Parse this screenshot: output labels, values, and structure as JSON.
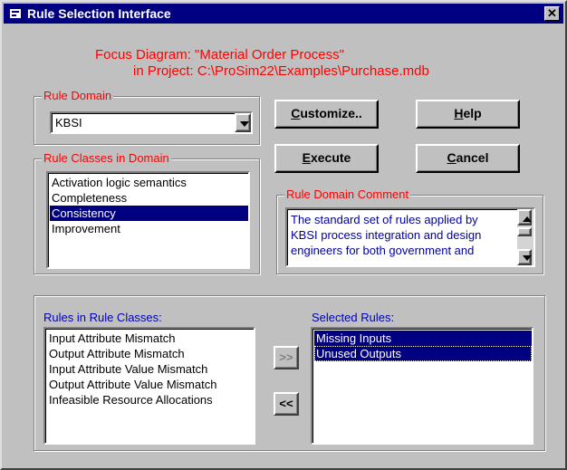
{
  "window": {
    "title": "Rule Selection Interface",
    "close_glyph": "✕"
  },
  "header": {
    "focus_line1": "Focus Diagram: \"Material Order Process\"",
    "focus_line2": "in Project: C:\\ProSim22\\Examples\\Purchase.mdb"
  },
  "rule_domain": {
    "legend": "Rule Domain",
    "selected": "KBSI"
  },
  "rule_classes": {
    "legend": "Rule Classes in Domain",
    "items": [
      "Activation logic semantics",
      "Completeness",
      "Consistency",
      "Improvement"
    ],
    "selected_index": 2
  },
  "buttons": {
    "customize_mn": "C",
    "customize_rest": "ustomize..",
    "help_mn": "H",
    "help_rest": "elp",
    "execute_mn": "E",
    "execute_rest": "xecute",
    "cancel_mn": "C",
    "cancel_rest": "ancel"
  },
  "comment": {
    "legend": "Rule Domain Comment",
    "text": "The standard set of rules applied by KBSI process integration and design engineers for both government and"
  },
  "rules": {
    "available_label": "Rules in Rule Classes:",
    "available": [
      "Input Attribute Mismatch",
      "Output Attribute Mismatch",
      "Input Attribute Value Mismatch",
      "Output Attribute Value Mismatch",
      "Infeasible Resource Allocations"
    ],
    "selected_label": "Selected Rules:",
    "selected": [
      "Missing Inputs",
      "Unused Outputs"
    ],
    "add_label": ">>",
    "remove_label": "<<"
  },
  "colors": {
    "title_bar": "#000080",
    "legend_text": "#ff0000",
    "list_label_text": "#0000c0",
    "selection": "#000080",
    "face": "#c0c0c0"
  },
  "icons": {
    "app": "app-icon",
    "close": "close-icon",
    "dropdown": "chevron-down-icon",
    "scroll_up": "scroll-up-icon",
    "scroll_down": "scroll-down-icon"
  }
}
